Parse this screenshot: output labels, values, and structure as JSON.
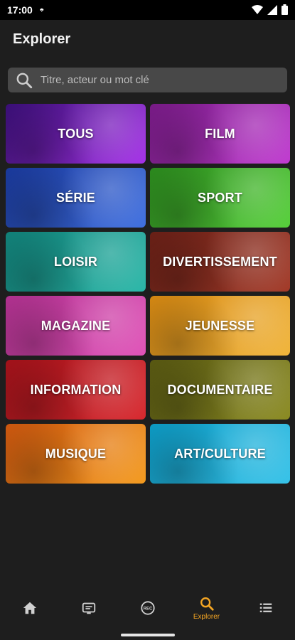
{
  "status": {
    "time": "17:00"
  },
  "header": {
    "title": "Explorer"
  },
  "search": {
    "placeholder": "Titre, acteur ou mot clé"
  },
  "categories": [
    {
      "label": "TOUS",
      "color1": "#3b0f7a",
      "color2": "#a531e8"
    },
    {
      "label": "FILM",
      "color1": "#7b1b8a",
      "color2": "#c03bd0"
    },
    {
      "label": "SÉRIE",
      "color1": "#1a3aa0",
      "color2": "#3f6fe0"
    },
    {
      "label": "SPORT",
      "color1": "#2c8c1e",
      "color2": "#56d03a"
    },
    {
      "label": "LOISIR",
      "color1": "#11847c",
      "color2": "#2ab7a8"
    },
    {
      "label": "DIVERTISSEMENT",
      "color1": "#6b2017",
      "color2": "#a33a28"
    },
    {
      "label": "MAGAZINE",
      "color1": "#b53293",
      "color2": "#e052b8"
    },
    {
      "label": "JEUNESSE",
      "color1": "#d98a12",
      "color2": "#f0b43a"
    },
    {
      "label": "INFORMATION",
      "color1": "#a6121a",
      "color2": "#d8282e"
    },
    {
      "label": "DOCUMENTAIRE",
      "color1": "#5a5a12",
      "color2": "#8b8b22"
    },
    {
      "label": "MUSIQUE",
      "color1": "#d3590f",
      "color2": "#f39a1e"
    },
    {
      "label": "ART/CULTURE",
      "color1": "#0c9ec9",
      "color2": "#36c2e8"
    }
  ],
  "nav": {
    "items": [
      {
        "icon": "home-icon",
        "label": ""
      },
      {
        "icon": "tv-guide-icon",
        "label": ""
      },
      {
        "icon": "rec-icon",
        "label": ""
      },
      {
        "icon": "search-icon",
        "label": "Explorer",
        "active": true
      },
      {
        "icon": "list-icon",
        "label": ""
      }
    ],
    "active_color": "#f5a623",
    "inactive_color": "#d0d0d0"
  }
}
